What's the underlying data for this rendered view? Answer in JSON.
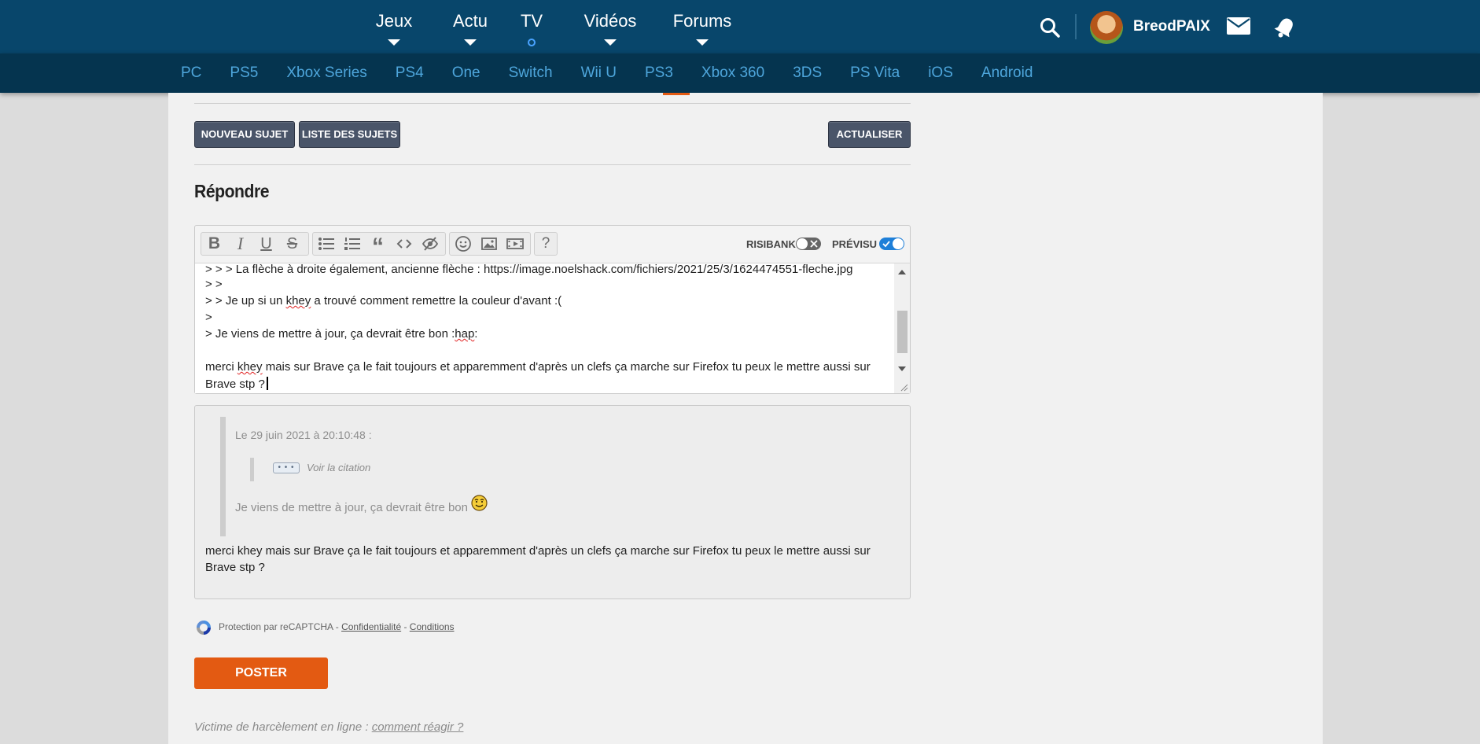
{
  "header": {
    "nav": [
      {
        "label": "Jeux",
        "marker": "caret"
      },
      {
        "label": "Actu",
        "marker": "caret"
      },
      {
        "label": "TV",
        "marker": "dot"
      },
      {
        "label": "Vidéos",
        "marker": "caret"
      },
      {
        "label": "Forums",
        "marker": "caret"
      }
    ],
    "username": "BreodPAIX",
    "icons": [
      "search-icon",
      "avatar",
      "mail-icon",
      "bell-icon"
    ]
  },
  "platforms": [
    "PC",
    "PS5",
    "Xbox Series",
    "PS4",
    "One",
    "Switch",
    "Wii U",
    "PS3",
    "Xbox 360",
    "3DS",
    "PS Vita",
    "iOS",
    "Android"
  ],
  "actions": {
    "new_topic": "NOUVEAU SUJET",
    "topic_list": "LISTE DES SUJETS",
    "refresh": "ACTUALISER"
  },
  "reply": {
    "title": "Répondre",
    "toolbar": {
      "risibank_label": "RISIBANK",
      "preview_label": "PRÉVISU",
      "risibank_on": false,
      "preview_on": true,
      "help_label": "?"
    },
    "editor_lines": {
      "l1": "> > > La flèche à droite également, ancienne flèche : https://image.noelshack.com/fichiers/2021/25/3/1624474551-fleche.jpg",
      "l2": "> >",
      "l3_a": "> > Je up si un ",
      "l3_b": "khey",
      "l3_c": " a trouvé comment remettre la couleur d'avant :(",
      "l4": ">",
      "l5_a": "> Je viens de mettre à jour, ça devrait être bon :",
      "l5_b": "hap",
      "l5_c": ":",
      "l6_a": "merci ",
      "l6_b": "khey",
      "l6_c": " mais sur Brave ça le fait toujours et apparemment d'après un clefs ça marche sur Firefox tu peux le mettre aussi sur",
      "l7": "Brave stp ?"
    }
  },
  "preview": {
    "quote_header": "Le 29 juin 2021 à 20:10:48 :",
    "show_quote": "Voir la citation",
    "quote_text": "Je viens de mettre à jour, ça devrait être bon",
    "message": "merci khey mais sur Brave ça le fait toujours et apparemment d'après un clefs ça marche sur Firefox tu peux le mettre aussi sur Brave stp ?"
  },
  "recaptcha": {
    "text": "Protection par reCAPTCHA - ",
    "privacy": "Confidentialité",
    "separator": " - ",
    "terms": "Conditions"
  },
  "post_button": "POSTER",
  "harassment": {
    "text": "Victime de harcèlement en ligne : ",
    "link": "comment réagir ?"
  },
  "colors": {
    "header": "#08466b",
    "subnav": "#05344f",
    "platform_link": "#4ea6dc",
    "accent": "#e35a12",
    "button_dark": "#4a5569",
    "toggle_on": "#1e7fd8"
  }
}
